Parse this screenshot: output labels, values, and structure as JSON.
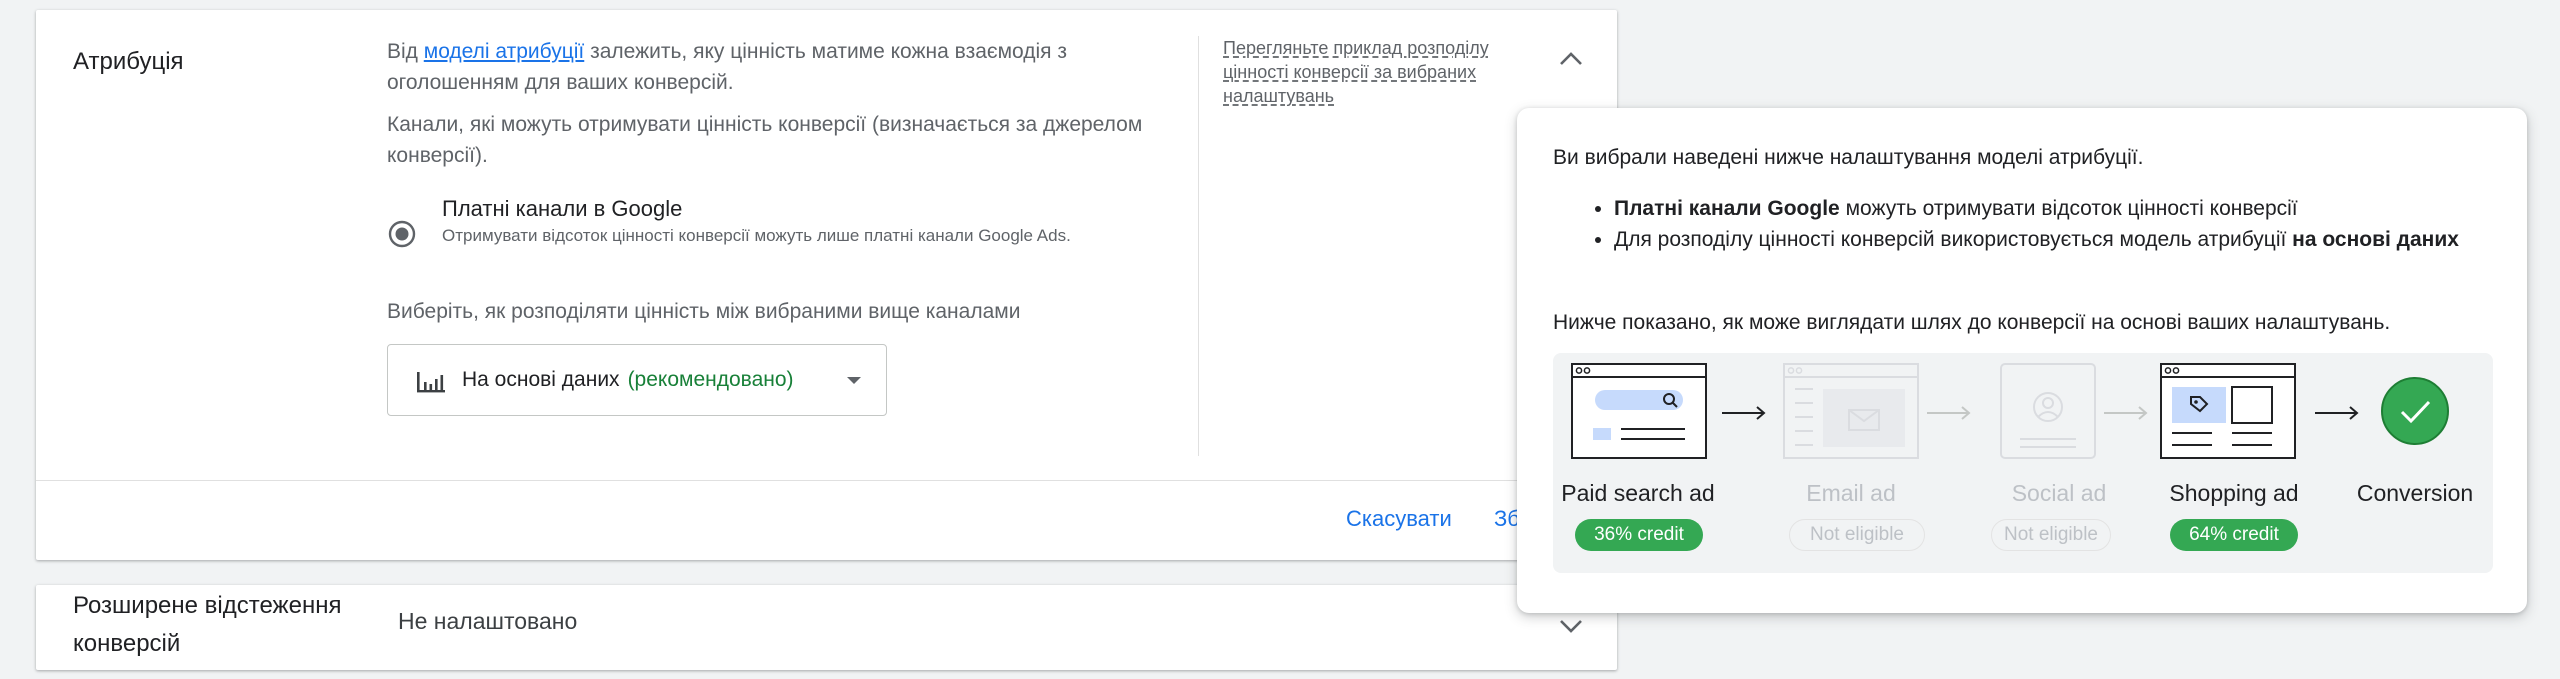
{
  "attribution": {
    "title": "Атрибуція",
    "desc1_pre": "Від ",
    "desc1_link": "моделі атрибуції",
    "desc1_post": " залежить, яку цінність матиме кожна взаємодія з оголошенням для ваших конверсій.",
    "desc2": "Канали, які можуть отримувати цінність конверсії (визначається за джерелом конверсії).",
    "option_title": "Платні канали в Google",
    "option_sub": "Отримувати відсоток цінності конверсії можуть лише платні канали Google Ads.",
    "dist_label": "Виберіть, як розподіляти цінність між вибраними вище каналами",
    "dropdown_value": "На основі даних",
    "dropdown_recommended": "(рекомендовано)",
    "example_link": "Перегляньте приклад розподілу цінності конверсії за вибраних налаштувань",
    "cancel_label": "Скасувати",
    "save_label": "Зб"
  },
  "enhanced": {
    "title": "Розширене відстеження конверсій",
    "value": "Не налаштовано"
  },
  "popover": {
    "intro": "Ви вибрали наведені нижче налаштування моделі атрибуції.",
    "bullet1_bold": "Платні канали Google",
    "bullet1_rest": " можуть отримувати відсоток цінності конверсії",
    "bullet2_pre": "Для розподілу цінності конверсій використовується модель атрибуції ",
    "bullet2_bold": "на основі даних",
    "path_text": "Нижче показано, як може виглядати шлях до конверсії на основі ваших налаштувань.",
    "steps": [
      {
        "label": "Paid search ad",
        "badge": "36% credit",
        "eligible": true
      },
      {
        "label": "Email ad",
        "badge": "Not eligible",
        "eligible": false
      },
      {
        "label": "Social ad",
        "badge": "Not eligible",
        "eligible": false
      },
      {
        "label": "Shopping ad",
        "badge": "64% credit",
        "eligible": true
      },
      {
        "label": "Conversion",
        "badge": "",
        "eligible": true
      }
    ]
  },
  "colors": {
    "link_blue": "#1a73e8",
    "green": "#34a853",
    "recommended_green": "#188038"
  },
  "icons": [
    "radio-selected-icon",
    "data-driven-bars-icon",
    "caret-down-icon",
    "chevron-up-icon",
    "chevron-down-icon",
    "search-ad-icon",
    "email-ad-icon",
    "social-ad-icon",
    "shopping-ad-icon",
    "checkmark-icon",
    "arrow-right-icon"
  ]
}
